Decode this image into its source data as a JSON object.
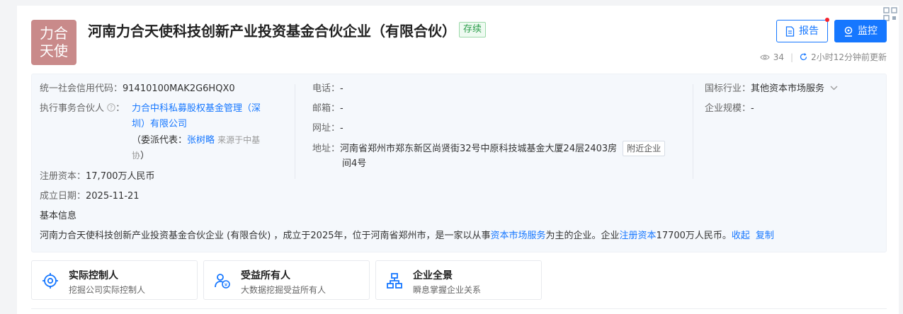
{
  "header": {
    "logo_text": "力合天使",
    "company_name": "河南力合天使科技创新产业投资基金合伙企业（有限合伙）",
    "status_tag": "存续",
    "report_label": "报告",
    "monitor_label": "监控",
    "view_count": "34",
    "updated": "2小时12分钟前更新"
  },
  "info": {
    "credit_code_label": "统一社会信用代码：",
    "credit_code": "91410100MAK2G6HQX0",
    "partner_label": "执行事务合伙人",
    "partner_line1": "力合中科私募股权基金管理（深",
    "partner_line2": "圳）有限公司",
    "delegate_prefix": "（委派代表：",
    "delegate_name": "张树略",
    "delegate_source": "来源于中基",
    "delegate_source2": "协",
    "delegate_suffix": "）",
    "capital_label": "注册资本：",
    "capital": "17,700万人民币",
    "founded_label": "成立日期：",
    "founded": "2025-11-21",
    "phone_label": "电话：",
    "phone": "-",
    "email_label": "邮箱：",
    "email": "-",
    "website_label": "网址：",
    "website": "-",
    "address_label": "地址：",
    "address_line1": "河南省郑州市郑东新区尚贤街32号中原科技城基金大厦24层2403房",
    "address_line2": "间4号",
    "nearby_label": "附近企业",
    "industry_label": "国标行业：",
    "industry": "其他资本市场服务",
    "scale_label": "企业规模：",
    "scale": "-",
    "basic_title": "基本信息",
    "desc_part1": "河南力合天使科技创新产业投资基金合伙企业 (有限合伙) ，成立于2025年，位于河南省郑州市，是一家以从事",
    "desc_link1": "资本市场服务",
    "desc_part2": "为主的企业。企业",
    "desc_link2": "注册资本",
    "desc_part3": "17700万人民币。",
    "collapse_label": "收起",
    "copy_label": "复制"
  },
  "features": [
    {
      "title": "实际控制人",
      "subtitle": "挖掘公司实际控制人",
      "icon": "target-icon"
    },
    {
      "title": "受益所有人",
      "subtitle": "大数据挖掘受益所有人",
      "icon": "beneficiary-icon"
    },
    {
      "title": "企业全景",
      "subtitle": "瞬息掌握企业关系",
      "icon": "org-chart-icon"
    }
  ],
  "colors": {
    "accent": "#1677ff",
    "status_green": "#2b9d4a",
    "logo_bg": "#c98a8a"
  }
}
